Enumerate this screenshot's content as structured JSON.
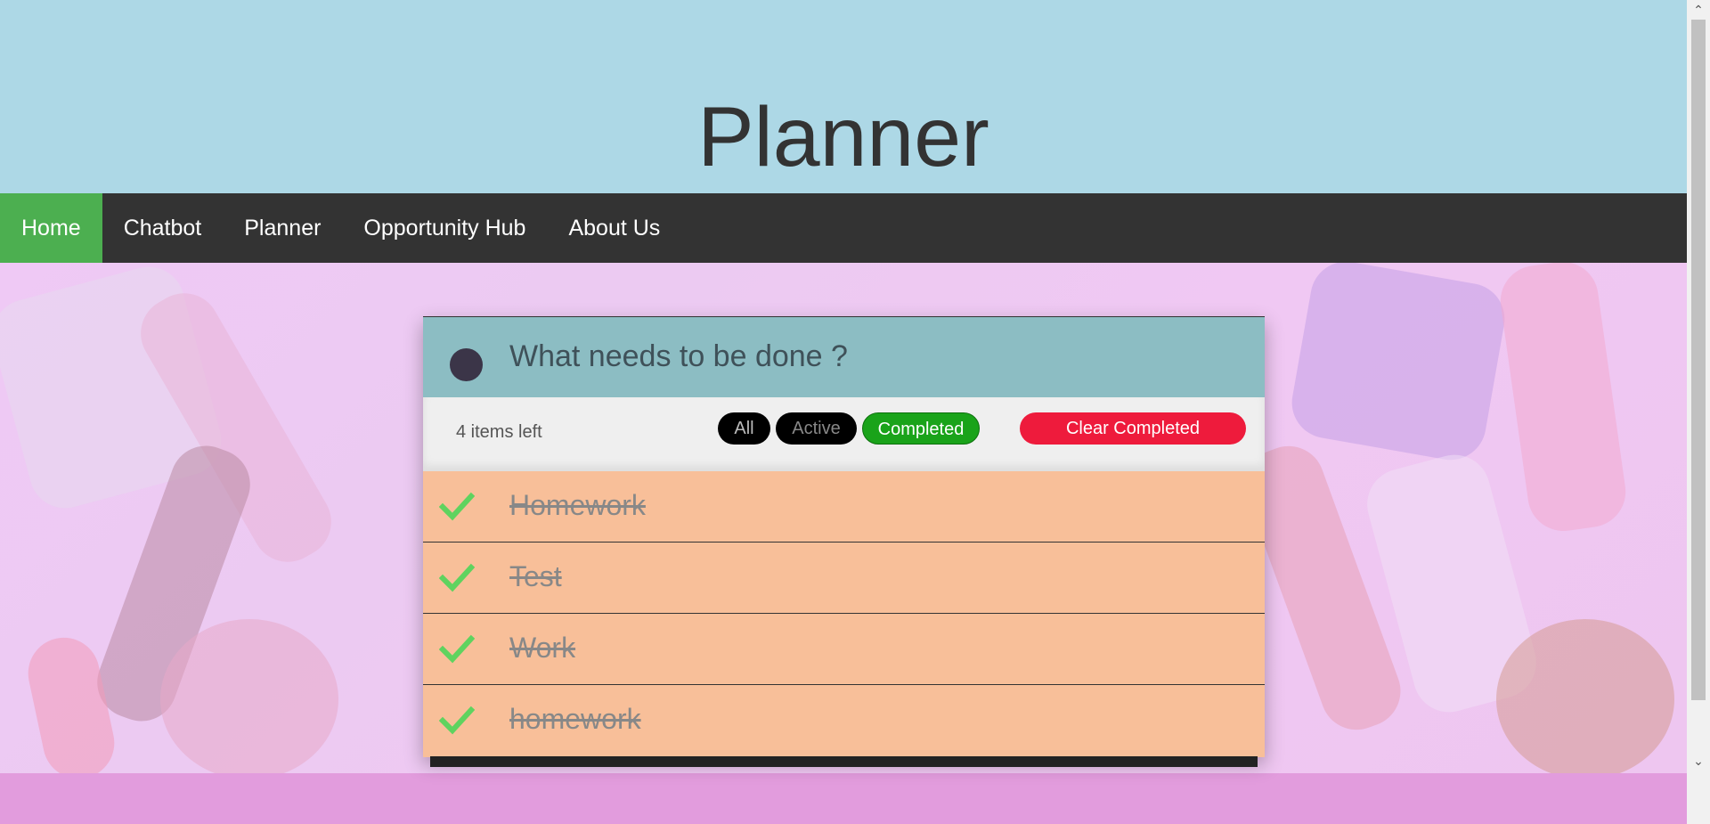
{
  "header": {
    "title": "Planner"
  },
  "nav": {
    "items": [
      {
        "label": "Home"
      },
      {
        "label": "Chatbot"
      },
      {
        "label": "Planner"
      },
      {
        "label": "Opportunity Hub"
      },
      {
        "label": "About Us"
      }
    ],
    "active_index": 0
  },
  "todo": {
    "input": {
      "placeholder": "What needs to be done ?",
      "value": ""
    },
    "items_left": "4 items left",
    "filters": {
      "all": "All",
      "active": "Active",
      "completed": "Completed",
      "selected": "Completed"
    },
    "clear_label": "Clear Completed",
    "items": [
      {
        "text": "Homework",
        "completed": true
      },
      {
        "text": "Test",
        "completed": true
      },
      {
        "text": "Work",
        "completed": true
      },
      {
        "text": "homework",
        "completed": true
      }
    ]
  },
  "colors": {
    "header_bg": "#add8e6",
    "nav_bg": "#333333",
    "nav_active": "#4caf50",
    "input_row_bg": "#8cbdc3",
    "item_bg": "#f8bf99",
    "check": "#5fd35f",
    "completed_pill": "#1aa31a",
    "clear_button": "#ee1b3c",
    "footer_bg": "#e29cdd"
  }
}
